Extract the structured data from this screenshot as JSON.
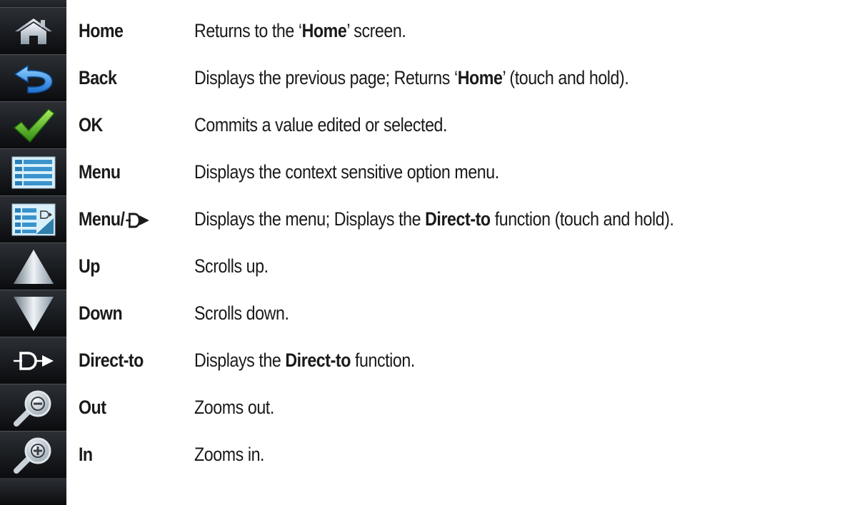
{
  "rows": [
    {
      "label": "Home",
      "desc_pre": "Returns to the ‘",
      "desc_bold": "Home",
      "desc_post": "’ screen.",
      "icon": "home-icon"
    },
    {
      "label": "Back",
      "desc_pre": "Displays the previous page;  Returns ‘",
      "desc_bold": "Home",
      "desc_post": "’ (touch and hold).",
      "icon": "back-icon"
    },
    {
      "label": "OK",
      "desc_pre": "Commits a value edited or selected.",
      "desc_bold": "",
      "desc_post": "",
      "icon": "checkmark-icon"
    },
    {
      "label": "Menu",
      "desc_pre": "Displays the context sensitive option menu.",
      "desc_bold": "",
      "desc_post": "",
      "icon": "menu-icon"
    },
    {
      "label": "Menu/",
      "desc_pre": "Displays the menu;  Displays the ",
      "desc_bold": "Direct-to",
      "desc_post": " function (touch and hold).",
      "icon": "menu-direct-to-icon"
    },
    {
      "label": "Up",
      "desc_pre": "Scrolls up.",
      "desc_bold": "",
      "desc_post": "",
      "icon": "up-arrow-icon"
    },
    {
      "label": "Down",
      "desc_pre": "Scrolls down.",
      "desc_bold": "",
      "desc_post": "",
      "icon": "down-arrow-icon"
    },
    {
      "label": "Direct-to",
      "desc_pre": "Displays the ",
      "desc_bold": "Direct-to",
      "desc_post": " function.",
      "icon": "direct-to-icon"
    },
    {
      "label": "Out",
      "desc_pre": "Zooms out.",
      "desc_bold": "",
      "desc_post": "",
      "icon": "zoom-out-icon"
    },
    {
      "label": "In",
      "desc_pre": "Zooms in.",
      "desc_bold": "",
      "desc_post": "",
      "icon": "zoom-in-icon"
    }
  ]
}
